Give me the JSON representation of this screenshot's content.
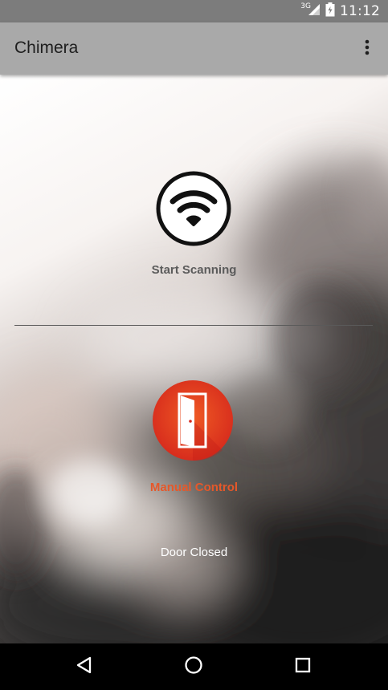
{
  "status_bar": {
    "network_type": "3G",
    "time": "11:12",
    "icons": [
      "signal-icon",
      "battery-icon"
    ]
  },
  "app_bar": {
    "title": "Chimera",
    "menu_icon": "overflow-menu-icon"
  },
  "main": {
    "scan": {
      "icon": "wifi-icon",
      "label": "Start Scanning"
    },
    "manual": {
      "icon": "door-icon",
      "label": "Manual Control"
    },
    "door_status": "Door Closed"
  },
  "nav_bar": {
    "icons": [
      "back-icon",
      "home-icon",
      "recents-icon"
    ]
  },
  "colors": {
    "status_bar": "#7c7c7c",
    "app_bar": "#a9a9a9",
    "accent": "#e5582a",
    "door_button": "#e8401f"
  }
}
